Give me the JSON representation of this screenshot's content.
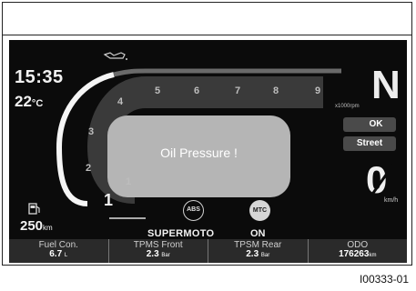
{
  "clock": "15:35",
  "temperature": {
    "value": "22",
    "unit": "°C"
  },
  "rpm": {
    "ticks": [
      "1",
      "2",
      "3",
      "4",
      "5",
      "6",
      "7",
      "8",
      "9"
    ],
    "unit": "x1000rpm"
  },
  "gear": "N",
  "status": {
    "ok_label": "OK",
    "mode_label": "Street"
  },
  "speed": "0",
  "speed_unit": "km/h",
  "fuel_range": {
    "value": "250",
    "unit": "km"
  },
  "warning": "Oil Pressure !",
  "indicators": {
    "abs": "ABS",
    "mtc": "MTC",
    "riding_mode": "SUPERMOTO",
    "mtc_state": "ON"
  },
  "info_bar": [
    {
      "label": "Fuel Con.",
      "value": "6.7",
      "unit": "L"
    },
    {
      "label": "TPMS Front",
      "value": "2.3",
      "unit": "Bar"
    },
    {
      "label": "TPSM Rear",
      "value": "2.3",
      "unit": "Bar"
    },
    {
      "label": "ODO",
      "value": "176263",
      "unit": "km"
    }
  ],
  "reference": "I00333-01",
  "icons": [
    "oil-can-icon",
    "fuel-pump-icon",
    "engine-temp-icon"
  ]
}
